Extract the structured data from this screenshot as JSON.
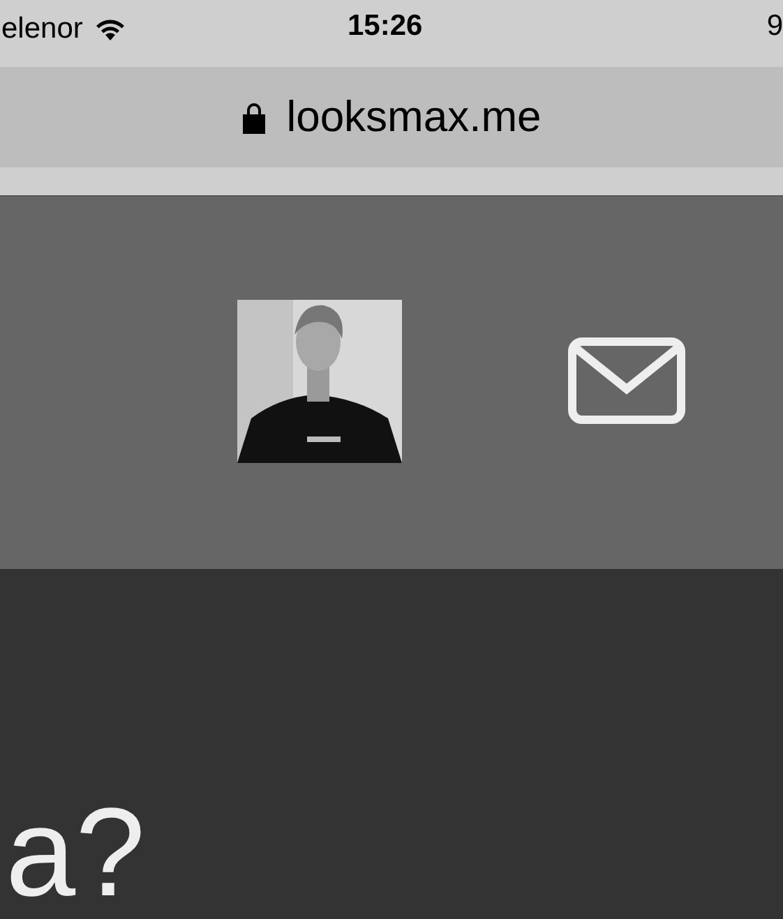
{
  "status_bar": {
    "carrier": "elenor",
    "time": "15:26",
    "battery": "9"
  },
  "address_bar": {
    "url": "looksmax.me"
  },
  "hero": {
    "heading": "a?"
  }
}
